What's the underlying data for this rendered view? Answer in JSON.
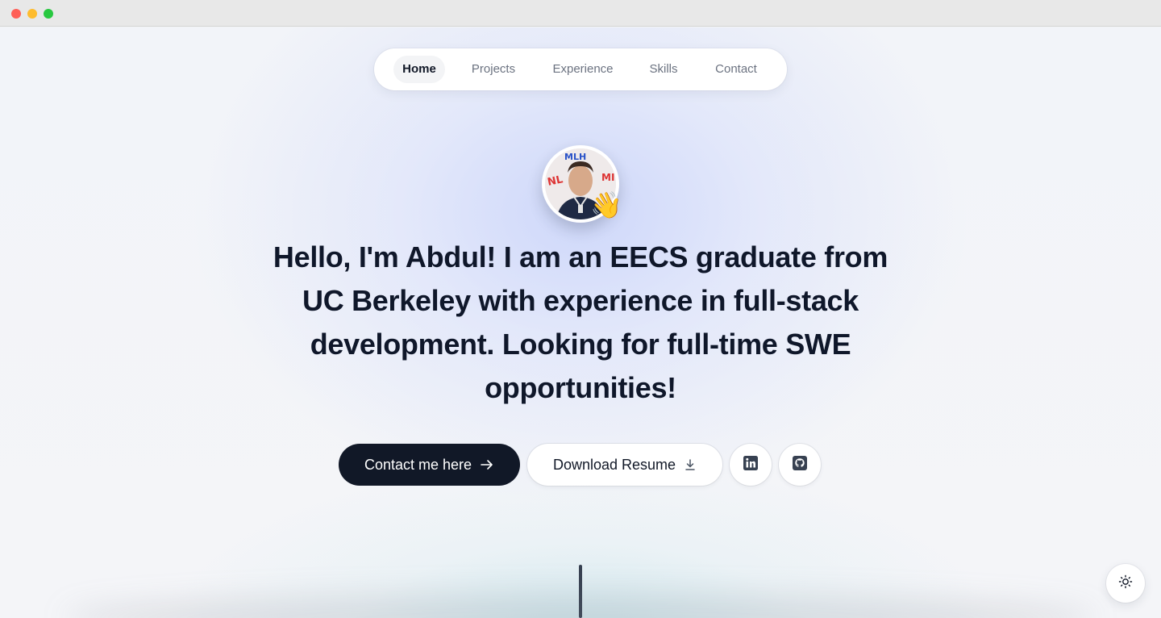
{
  "window": {
    "controls": [
      "close",
      "minimize",
      "maximize"
    ]
  },
  "nav": {
    "items": [
      {
        "label": "Home",
        "active": true
      },
      {
        "label": "Projects",
        "active": false
      },
      {
        "label": "Experience",
        "active": false
      },
      {
        "label": "Skills",
        "active": false
      },
      {
        "label": "Contact",
        "active": false
      }
    ]
  },
  "hero": {
    "avatar_icon": "profile-photo",
    "wave_emoji": "👋",
    "headline": "Hello, I'm Abdul! I am an EECS graduate from UC Berkeley with experience in full-stack development. Looking for full-time SWE opportunities!"
  },
  "actions": {
    "contact_label": "Contact me here",
    "contact_icon": "arrow-right-icon",
    "resume_label": "Download Resume",
    "resume_icon": "download-icon",
    "linkedin_icon": "linkedin-icon",
    "github_icon": "github-icon"
  },
  "theme_toggle": {
    "icon": "sun-icon"
  },
  "colors": {
    "primary_button": "#111827",
    "text": "#0f172a",
    "nav_inactive": "#6b7280"
  }
}
